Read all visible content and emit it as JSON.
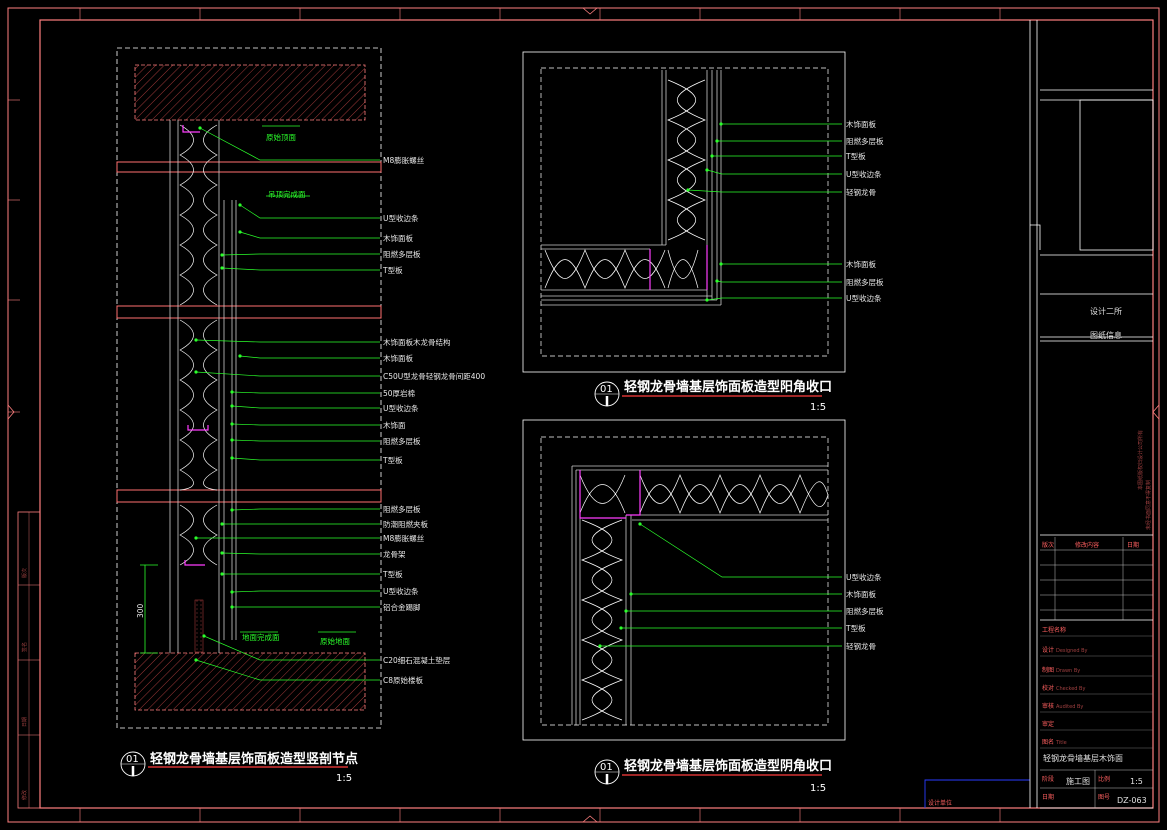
{
  "drawing": {
    "detail_left": {
      "number": "01",
      "title": "轻钢龙骨墙基层饰面板造型竖剖节点",
      "scale": "1:5",
      "labels": [
        "M8膨胀螺丝",
        "U型收边条",
        "木饰面板",
        "阻燃多层板",
        "T型板",
        "木饰面板木龙骨结构",
        "木饰面板",
        "C50U型龙骨轻钢龙骨间距400",
        "50厚岩棉",
        "U型收边条",
        "木饰面",
        "阻燃多层板",
        "T型板",
        "阻燃多层板",
        "防潮阻燃夹板",
        "M8膨胀螺丝",
        "龙骨架",
        "T型板",
        "U型收边条",
        "铝合金踢脚",
        "C20细石混凝土垫层",
        "C8原始楼板"
      ],
      "notes": [
        "原始顶面",
        "吊顶完成面",
        "地面完成面",
        "原始地面"
      ],
      "dim": "300"
    },
    "detail_top_right": {
      "number": "01",
      "title": "轻钢龙骨墙基层饰面板造型阳角收口",
      "scale": "1:5",
      "labels": [
        "木饰面板",
        "阻燃多层板",
        "T型板",
        "U型收边条",
        "轻钢龙骨",
        "木饰面板",
        "阻燃多层板",
        "U型收边条"
      ]
    },
    "detail_bottom_right": {
      "number": "01",
      "title": "轻钢龙骨墙基层饰面板造型阴角收口",
      "scale": "1:5",
      "labels": [
        "U型收边条",
        "木饰面板",
        "阻燃多层板",
        "T型板",
        "轻钢龙骨"
      ]
    }
  },
  "title_block": {
    "company_1": "设计二所",
    "company_2": "图纸信息",
    "vertical_notes": [
      "本图纸版权归设计公司所有",
      "未经书面同意不得复制"
    ],
    "rev_header": [
      "版次",
      "修改内容",
      "日期"
    ],
    "fields": [
      {
        "label": "工程名称",
        "en": ""
      },
      {
        "label": "设计",
        "en": "Designed By"
      },
      {
        "label": "制图",
        "en": "Drawn By"
      },
      {
        "label": "校对",
        "en": "Checked By"
      },
      {
        "label": "审核",
        "en": "Audited By"
      },
      {
        "label": "审定",
        "en": ""
      },
      {
        "label": "图名",
        "en": "Title"
      }
    ],
    "drawing_name": "轻钢龙骨墙基层木饰面",
    "stage_label": "阶段",
    "stage": "施工图",
    "scale_label": "比例",
    "scale": "1:5",
    "date_label": "日期",
    "number_label": "图号",
    "number": "DZ-063",
    "stamp": "设计单位"
  },
  "left_strip": [
    "版次",
    "签名",
    "日期",
    "修改"
  ],
  "colors": {
    "frame": "#ff7f7f",
    "leader": "#2bff2b",
    "pink": "#ff3dff",
    "wall": "#cccccc",
    "hatch": "#b04040"
  }
}
